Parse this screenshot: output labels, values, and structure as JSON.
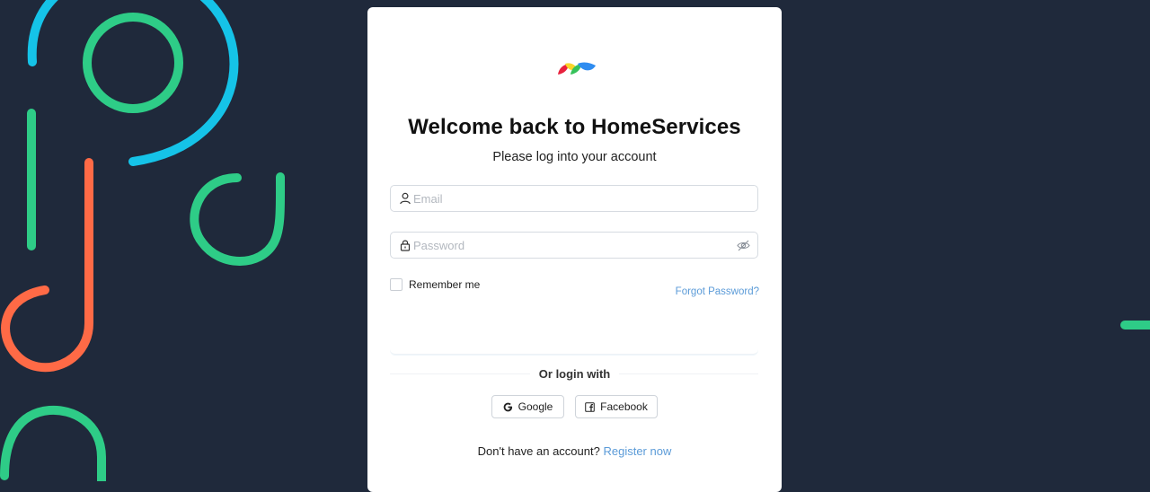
{
  "brand": {
    "colors": [
      "#e8213d",
      "#f9d52a",
      "#37c25b",
      "#2f8cf0"
    ]
  },
  "login": {
    "title": "Welcome back to HomeServices",
    "subtitle": "Please log into your account",
    "email": {
      "placeholder": "Email",
      "value": "",
      "icon": "user-icon"
    },
    "password": {
      "placeholder": "Password",
      "value": "",
      "icon": "lock-icon",
      "toggle_icon": "eye-off-icon"
    },
    "remember_label": "Remember me",
    "remember_checked": false,
    "forgot_label": "Forgot Password?",
    "divider_label": "Or login with",
    "social": [
      {
        "label": "Google",
        "icon": "google-icon"
      },
      {
        "label": "Facebook",
        "icon": "facebook-icon"
      }
    ],
    "register_prompt": "Don't have an account?",
    "register_link": "Register now"
  },
  "theme": {
    "background": "#1f293b",
    "accent_link": "#5b9bd8",
    "art_colors": [
      "#15c3e8",
      "#2ecc87",
      "#ff6a46"
    ]
  }
}
